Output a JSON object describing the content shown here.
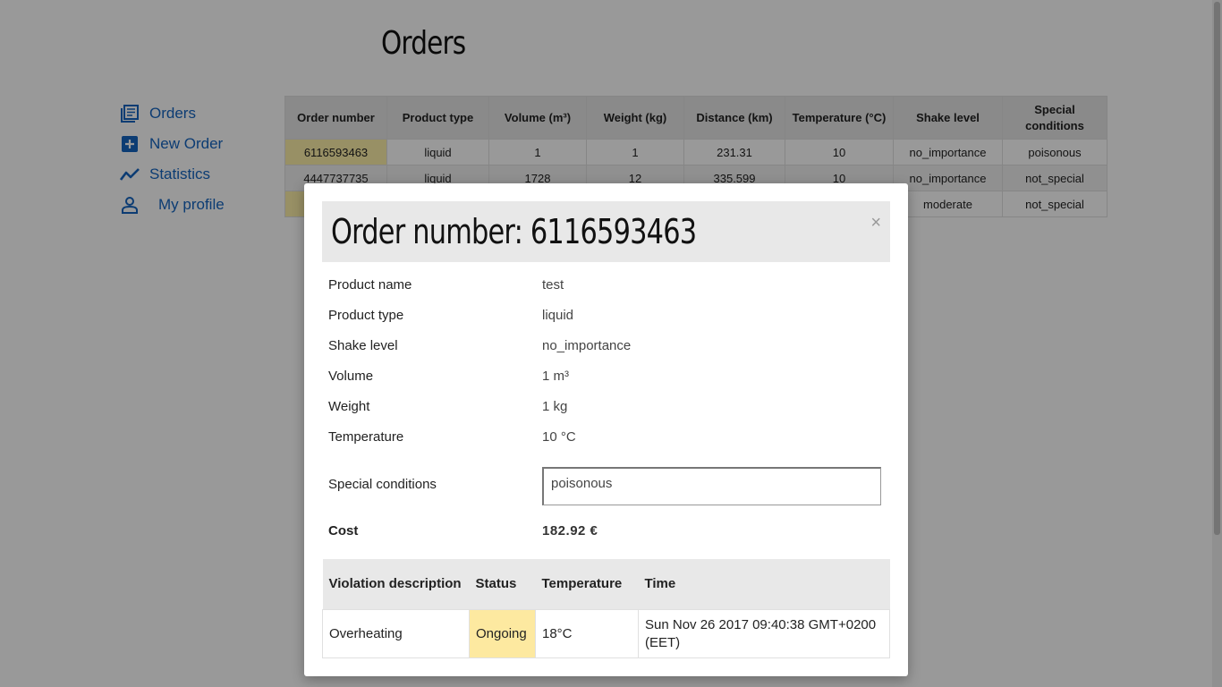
{
  "page": {
    "title": "Orders"
  },
  "sidebar": {
    "items": [
      {
        "label": "Orders",
        "icon": "orders-list-icon"
      },
      {
        "label": "New Order",
        "icon": "plus-box-icon"
      },
      {
        "label": "Statistics",
        "icon": "trend-line-icon"
      },
      {
        "label": "My profile",
        "icon": "person-icon"
      }
    ]
  },
  "orders_table": {
    "headers": [
      "Order number",
      "Product type",
      "Volume (m³)",
      "Weight (kg)",
      "Distance (km)",
      "Temperature (°C)",
      "Shake level",
      "Special conditions"
    ],
    "rows": [
      [
        "6116593463",
        "liquid",
        "1",
        "1",
        "231.31",
        "10",
        "no_importance",
        "poisonous"
      ],
      [
        "4447737735",
        "liquid",
        "1728",
        "12",
        "335.599",
        "10",
        "no_importance",
        "not_special"
      ],
      [
        "",
        "",
        "",
        "",
        "",
        "",
        "moderate",
        "not_special"
      ]
    ]
  },
  "modal": {
    "title": "Order number: 6116593463",
    "close": "×",
    "details": [
      {
        "label": "Product name",
        "value": "test"
      },
      {
        "label": "Product type",
        "value": "liquid"
      },
      {
        "label": "Shake level",
        "value": "no_importance"
      },
      {
        "label": "Volume",
        "value": "1 m³"
      },
      {
        "label": "Weight",
        "value": "1 kg"
      },
      {
        "label": "Temperature",
        "value": "10 °C"
      }
    ],
    "special_conditions": {
      "label": "Special conditions",
      "value": "poisonous"
    },
    "cost": {
      "label": "Cost",
      "value": "182.92 €"
    },
    "violations": {
      "headers": [
        "Violation description",
        "Status",
        "Temperature",
        "Time"
      ],
      "rows": [
        [
          "Overheating",
          "Ongoing",
          "18°C",
          "Sun Nov 26 2017 09:40:38 GMT+0200 (EET)"
        ]
      ]
    }
  },
  "colors": {
    "accent": "#1565c0",
    "order_highlight": "#fdf0a8",
    "status_ongoing": "#fde9a0"
  }
}
